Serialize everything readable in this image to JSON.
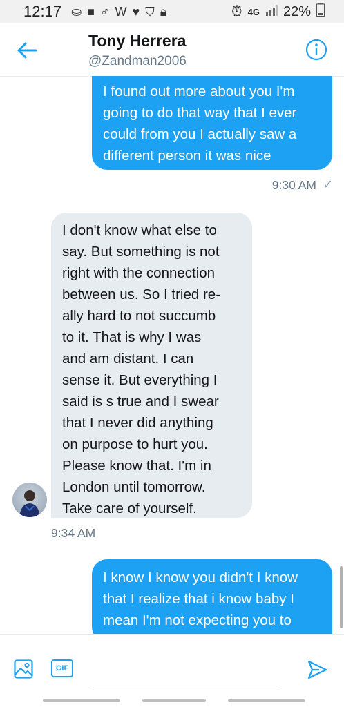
{
  "status_bar": {
    "time": "12:17",
    "network": "4G",
    "battery": "22%"
  },
  "header": {
    "name": "Tony Herrera",
    "handle": "@Zandman2006"
  },
  "messages": [
    {
      "direction": "outgoing",
      "lines": [
        "I found out more about you I'm",
        "going to do that way that I ever",
        "could from you I actually saw a",
        "different person it was nice"
      ],
      "time": "9:30 AM",
      "read_mark": "✓"
    },
    {
      "direction": "incoming",
      "lines": [
        "I don't know what else to",
        "say. But something is not",
        "right with the connection",
        "between us. So I tried re-",
        "ally hard to not succumb",
        "to it. That is why I was",
        "and am distant. I can",
        "sense it. But everything I",
        "said is s true and I swear",
        "that I never did anything",
        "on purpose to hurt you.",
        "Please know that. I'm in",
        "London until tomorrow.",
        "Take care of yourself."
      ],
      "time": "9:34 AM"
    },
    {
      "direction": "outgoing",
      "lines": [
        "I know I know you didn't I know",
        "that I realize that i know baby I",
        "mean I'm not expecting you to"
      ]
    }
  ],
  "composer": {
    "gif_label": "GIF",
    "placeholder": ""
  },
  "colors": {
    "accent": "#1da1f2",
    "incoming_bubble": "#e6ecf0",
    "muted_text": "#657786"
  },
  "icons": [
    "back-arrow-icon",
    "info-icon",
    "image-icon",
    "gif-icon",
    "send-icon"
  ]
}
